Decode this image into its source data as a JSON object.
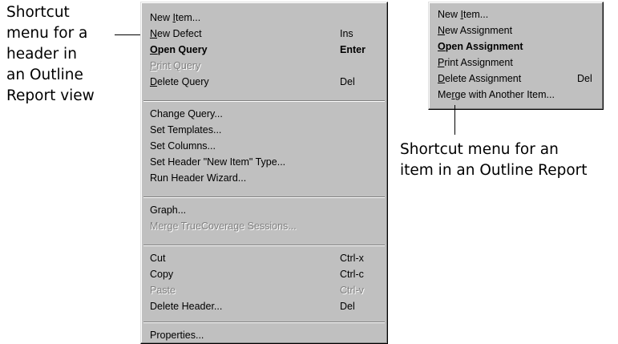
{
  "left_callout": {
    "lines": [
      "Shortcut",
      "menu for a",
      "header in",
      "an Outline",
      "Report view"
    ]
  },
  "right_callout": {
    "lines": [
      "Shortcut menu for an",
      "item in an Outline Report"
    ]
  },
  "header_menu": {
    "items": [
      {
        "pre": "New ",
        "ul": "I",
        "post": "tem...",
        "shortcut": ""
      },
      {
        "pre": "",
        "ul": "N",
        "post": "ew Defect",
        "shortcut": "Ins"
      },
      {
        "pre": "",
        "ul": "O",
        "post": "pen Query",
        "shortcut": "Enter"
      },
      {
        "pre": "",
        "ul": "P",
        "post": "rint Query",
        "shortcut": ""
      },
      {
        "pre": "",
        "ul": "D",
        "post": "elete Query",
        "shortcut": "Del"
      },
      {
        "pre": "Change Query...",
        "ul": "",
        "post": "",
        "shortcut": ""
      },
      {
        "pre": "Set Templates...",
        "ul": "",
        "post": "",
        "shortcut": ""
      },
      {
        "pre": "Set Columns...",
        "ul": "",
        "post": "",
        "shortcut": ""
      },
      {
        "pre": "Set Header \"New Item\" Type...",
        "ul": "",
        "post": "",
        "shortcut": ""
      },
      {
        "pre": "Run Header Wizard...",
        "ul": "",
        "post": "",
        "shortcut": ""
      },
      {
        "pre": "Graph...",
        "ul": "",
        "post": "",
        "shortcut": ""
      },
      {
        "pre": "Merge TrueCoverage Sessions...",
        "ul": "",
        "post": "",
        "shortcut": ""
      },
      {
        "pre": "Cut",
        "ul": "",
        "post": "",
        "shortcut": "Ctrl-x"
      },
      {
        "pre": "Copy",
        "ul": "",
        "post": "",
        "shortcut": "Ctrl-c"
      },
      {
        "pre": "Paste",
        "ul": "",
        "post": "",
        "shortcut": "Ctrl-v"
      },
      {
        "pre": "Delete Header...",
        "ul": "",
        "post": "",
        "shortcut": "Del"
      },
      {
        "pre": "Properties...",
        "ul": "",
        "post": "",
        "shortcut": ""
      }
    ]
  },
  "item_menu": {
    "items": [
      {
        "pre": "New ",
        "ul": "I",
        "post": "tem...",
        "shortcut": ""
      },
      {
        "pre": "",
        "ul": "N",
        "post": "ew Assignment",
        "shortcut": ""
      },
      {
        "pre": "",
        "ul": "O",
        "post": "pen Assignment",
        "shortcut": ""
      },
      {
        "pre": "",
        "ul": "P",
        "post": "rint Assignment",
        "shortcut": ""
      },
      {
        "pre": "",
        "ul": "D",
        "post": "elete Assignment",
        "shortcut": "Del"
      },
      {
        "pre": "Me",
        "ul": "r",
        "post": "ge with Another Item...",
        "shortcut": ""
      }
    ]
  }
}
